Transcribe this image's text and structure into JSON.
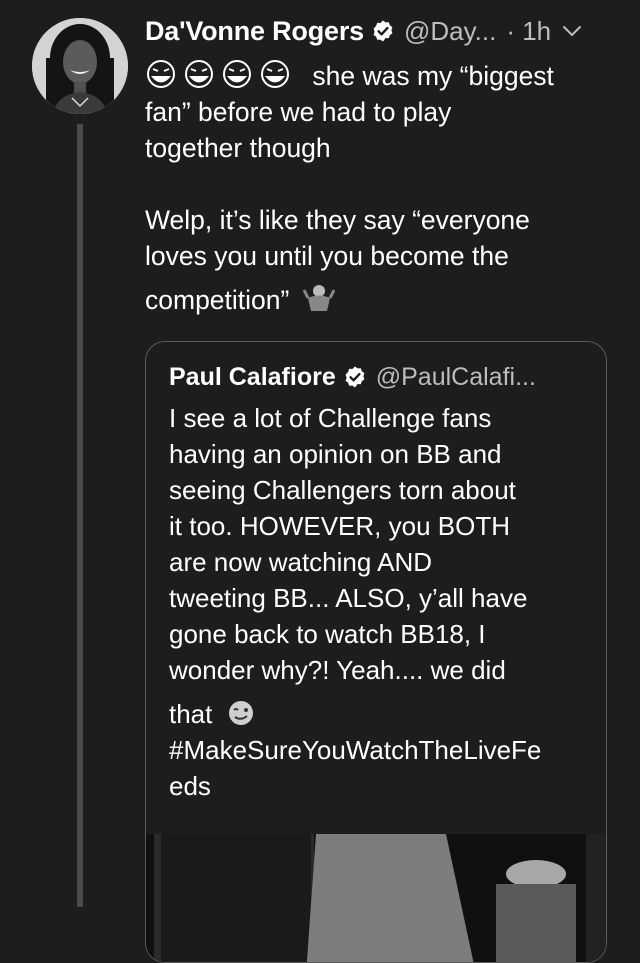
{
  "tweet": {
    "author_name": "Da'Vonne Rogers",
    "handle": "@Day...",
    "time": "· 1h",
    "verified": true,
    "emoji_lead": [
      "face-with-tears-of-joy",
      "face-with-tears-of-joy",
      "face-with-tears-of-joy",
      "face-with-tears-of-joy"
    ],
    "text_line1": "she was my “biggest",
    "text_line2": "fan” before we had to play",
    "text_line3": "together though",
    "text_line4": "Welp, it’s like they say “everyone",
    "text_line5": "loves you until you become the",
    "text_line6": "competition”",
    "emoji_trail": "person-shrugging"
  },
  "quote": {
    "author_name": "Paul Calafiore",
    "handle": "@PaulCalafi...",
    "verified": true,
    "lines": [
      "I see a lot of Challenge fans",
      "having an opinion on BB and",
      "seeing Challengers torn about",
      "it too. HOWEVER, you BOTH",
      "are now watching AND",
      "tweeting BB... ALSO, y’all have",
      "gone back to watch BB18, I",
      "wonder why?! Yeah.... we did"
    ],
    "last_line_text": "that",
    "last_line_emoji": "winking-face",
    "hashtag_line1": "#MakeSureYouWatchTheLiveFe",
    "hashtag_line2": "eds"
  },
  "colors": {
    "background": "#1d1d1d",
    "text": "#ffffff",
    "secondary_text": "#bdbdbd",
    "border": "#5a5a5a",
    "thread_line": "#4a4a4a"
  }
}
